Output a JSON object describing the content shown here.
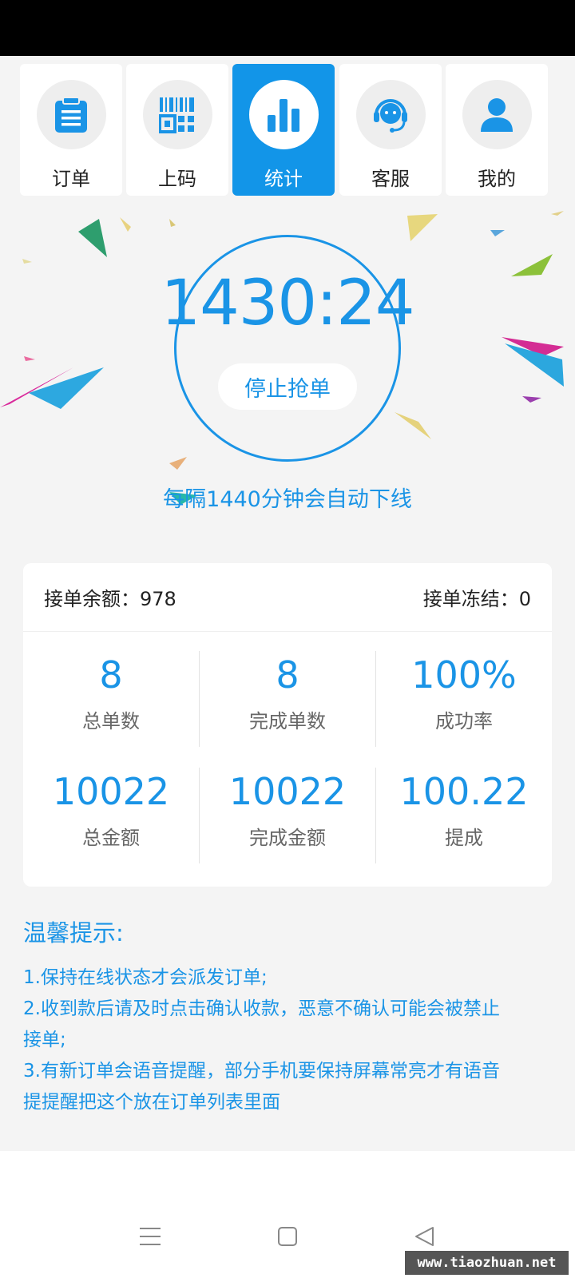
{
  "nav": {
    "tabs": [
      {
        "label": "订单",
        "icon": "clipboard-icon"
      },
      {
        "label": "上码",
        "icon": "qrcode-icon"
      },
      {
        "label": "统计",
        "icon": "bar-chart-icon",
        "active": true
      },
      {
        "label": "客服",
        "icon": "headset-icon"
      },
      {
        "label": "我的",
        "icon": "user-icon"
      }
    ]
  },
  "timer": {
    "value": "1430:24",
    "stop_label": "停止抢单",
    "auto_offline_notice": "每隔1440分钟会自动下线"
  },
  "stats": {
    "balance_label": "接单余额：978",
    "frozen_label": "接单冻结：0",
    "cells": [
      {
        "value": "8",
        "label": "总单数"
      },
      {
        "value": "8",
        "label": "完成单数"
      },
      {
        "value": "100%",
        "label": "成功率"
      },
      {
        "value": "10022",
        "label": "总金额"
      },
      {
        "value": "10022",
        "label": "完成金额"
      },
      {
        "value": "100.22",
        "label": "提成"
      }
    ]
  },
  "tips": {
    "title": "温馨提示:",
    "lines": [
      "1.保持在线状态才会派发订单;",
      "2.收到款后请及时点击确认收款，恶意不确认可能会被禁止",
      "接单;",
      "3.有新订单会语音提醒，部分手机要保持屏幕常亮才有语音",
      "提提醒把这个放在订单列表里面"
    ]
  },
  "watermark": "www.tiaozhuan.net",
  "colors": {
    "accent": "#1a94e6",
    "active_tab": "#1295e8"
  }
}
